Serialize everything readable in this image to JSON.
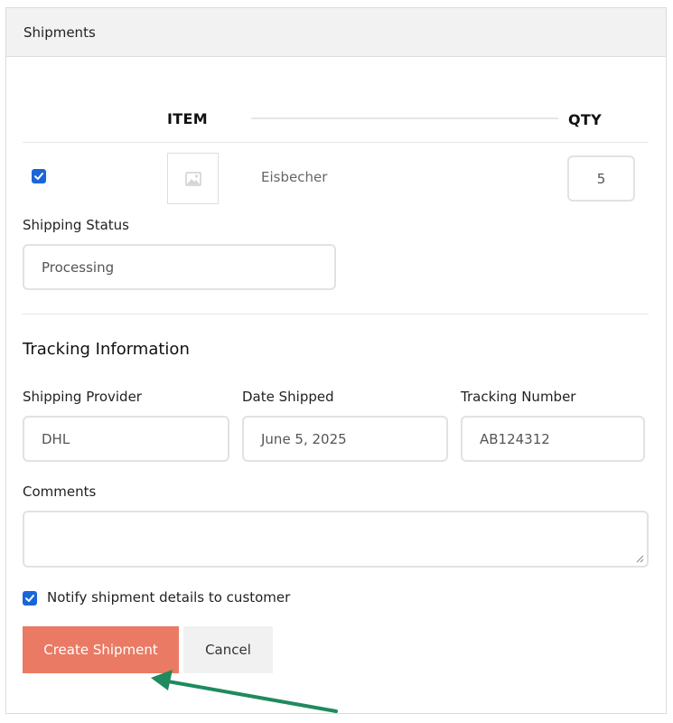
{
  "panel": {
    "title": "Shipments"
  },
  "table": {
    "headers": {
      "item": "ITEM",
      "qty": "QTY"
    },
    "rows": [
      {
        "checked": true,
        "name": "Eisbecher",
        "qty": "5"
      }
    ]
  },
  "shipping_status": {
    "label": "Shipping Status",
    "value": "Processing"
  },
  "tracking": {
    "title": "Tracking Information",
    "provider": {
      "label": "Shipping Provider",
      "value": "DHL"
    },
    "date_shipped": {
      "label": "Date Shipped",
      "value": "June 5, 2025"
    },
    "tracking_number": {
      "label": "Tracking Number",
      "value": "AB124312"
    }
  },
  "comments": {
    "label": "Comments",
    "value": ""
  },
  "notify": {
    "checked": true,
    "label": "Notify shipment details to customer"
  },
  "buttons": {
    "create": "Create Shipment",
    "cancel": "Cancel"
  },
  "colors": {
    "primary": "#ea7a64",
    "checkbox": "#1a66d9",
    "arrow": "#1f8a5e"
  }
}
